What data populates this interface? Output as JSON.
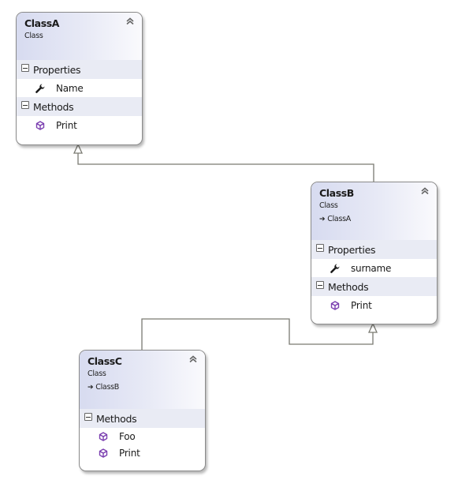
{
  "diagram": {
    "type": "class-diagram",
    "relationship": "inheritance",
    "colors": {
      "header_gradient_start": "#d7dbf0",
      "header_gradient_end": "#fafafd",
      "section_background": "#e9ebf4",
      "border": "#8a8a8a",
      "connector": "#7a7a72",
      "method_icon": "#7b3fb0",
      "property_icon": "#1a1a1a"
    }
  },
  "classes": {
    "classA": {
      "name": "ClassA",
      "kind": "Class",
      "collapse_glyph": "⌃",
      "properties_label": "Properties",
      "properties": [
        {
          "name": "Name",
          "icon": "wrench-icon"
        }
      ],
      "methods_label": "Methods",
      "methods": [
        {
          "name": "Print",
          "icon": "method-cube-icon"
        }
      ]
    },
    "classB": {
      "name": "ClassB",
      "kind": "Class",
      "base_arrow": "➔",
      "base": "ClassA",
      "properties_label": "Properties",
      "properties": [
        {
          "name": "surname",
          "icon": "wrench-icon"
        }
      ],
      "methods_label": "Methods",
      "methods": [
        {
          "name": "Print",
          "icon": "method-cube-icon"
        }
      ]
    },
    "classC": {
      "name": "ClassC",
      "kind": "Class",
      "base_arrow": "➔",
      "base": "ClassB",
      "methods_label": "Methods",
      "methods": [
        {
          "name": "Foo",
          "icon": "method-cube-icon"
        },
        {
          "name": "Print",
          "icon": "method-cube-icon"
        }
      ]
    }
  },
  "edges": [
    {
      "from": "ClassB",
      "to": "ClassA",
      "type": "inherits"
    },
    {
      "from": "ClassC",
      "to": "ClassB",
      "type": "inherits"
    }
  ]
}
